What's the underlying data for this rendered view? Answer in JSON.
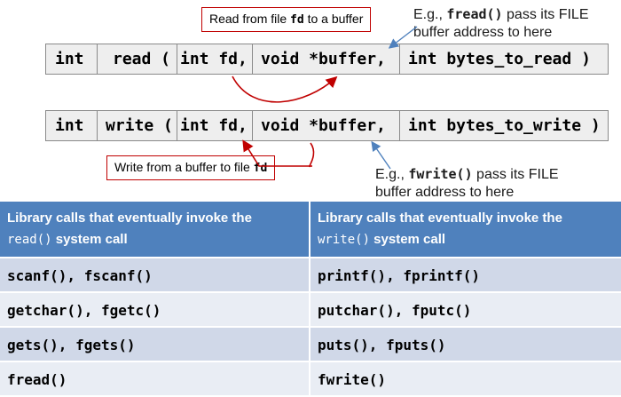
{
  "read_sig": {
    "ret": "int",
    "name": "read (",
    "p1": "int fd,",
    "p2": "void *buffer,",
    "p3": "int bytes_to_read )"
  },
  "write_sig": {
    "ret": "int",
    "name": "write (",
    "p1": "int fd,",
    "p2": "void *buffer,",
    "p3": "int bytes_to_write )"
  },
  "read_callout": {
    "prefix": "Read from file ",
    "code": "fd",
    "suffix": " to a buffer"
  },
  "write_callout": {
    "prefix": "Write from a buffer to file ",
    "code": "fd"
  },
  "fread_note": {
    "prefix": "E.g., ",
    "code": "fread()",
    "line1_suffix": " pass its FILE",
    "line2": "buffer address to here"
  },
  "fwrite_note": {
    "prefix": "E.g., ",
    "code": "fwrite()",
    "line1_suffix": " pass its FILE",
    "line2": "buffer address to here"
  },
  "table": {
    "header_left": {
      "line1": "Library calls that eventually invoke the",
      "code": "read()",
      "rest": " system call"
    },
    "header_right": {
      "line1": "Library calls that eventually invoke the",
      "code": "write()",
      "rest": " system call"
    },
    "rows": [
      {
        "left": "scanf(), fscanf()",
        "right": "printf(), fprintf()"
      },
      {
        "left": "getchar(), fgetc()",
        "right": "putchar(), fputc()"
      },
      {
        "left": "gets(), fgets()",
        "right": "puts(), fputs()"
      },
      {
        "left": "fread()",
        "right": "fwrite()"
      }
    ]
  },
  "colors": {
    "header": "#4f81bd",
    "row_odd": "#d0d8e8",
    "row_even": "#e9edf4",
    "callout_border": "#c00000",
    "arrow_blue": "#4f81bd"
  }
}
